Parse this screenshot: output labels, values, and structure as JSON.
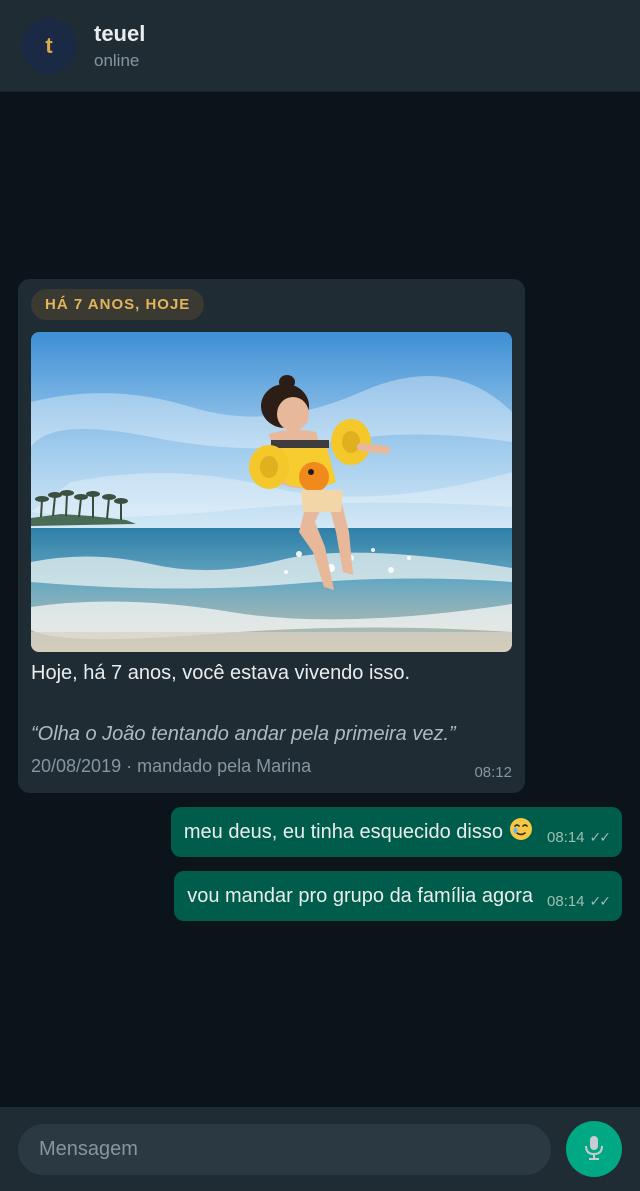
{
  "header": {
    "avatar_initial": "t",
    "contact_name": "teuel",
    "status": "online"
  },
  "memory_card": {
    "badge": "HÁ 7 ANOS, HOJE",
    "photo_icon": "beach-photo",
    "caption": "Hoje, há 7 anos, você estava vivendo isso.",
    "quote": "“Olha o João tentando andar pela primeira vez.”",
    "meta": "20/08/2019 · mandado pela Marina",
    "time": "08:12"
  },
  "messages": [
    {
      "text": "meu deus, eu tinha esquecido disso",
      "emoji": "face-holding-back-tears-icon",
      "time": "08:14",
      "status": "✓✓"
    },
    {
      "text": "vou mandar pro grupo da família agora",
      "time": "08:14",
      "status": "✓✓"
    }
  ],
  "composer": {
    "placeholder": "Mensagem",
    "mic_icon": "microphone-icon"
  },
  "colors": {
    "background": "#0c141b",
    "header": "#1f2c34",
    "incoming_bubble": "#202c33",
    "outgoing_bubble": "#005c4b",
    "badge_text": "#e0b55c",
    "accent": "#00a884"
  }
}
